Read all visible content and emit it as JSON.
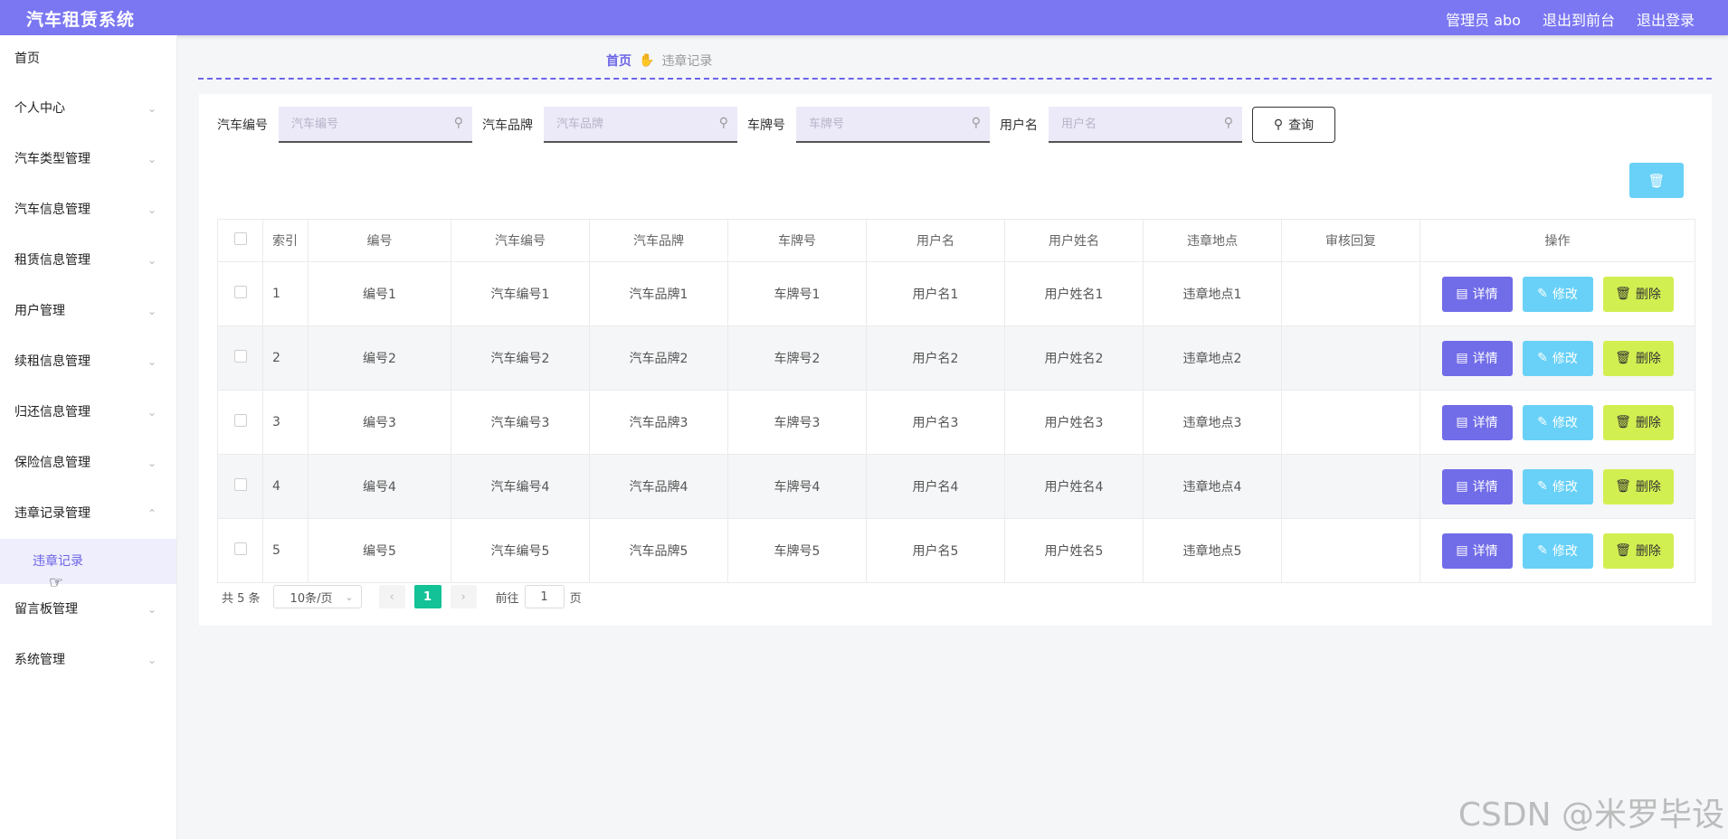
{
  "app": {
    "title": "汽车租赁系统"
  },
  "topnav": {
    "admin": "管理员 abo",
    "to_front": "退出到前台",
    "logout": "退出登录"
  },
  "sidebar": {
    "items": [
      {
        "label": "首页"
      },
      {
        "label": "个人中心"
      },
      {
        "label": "汽车类型管理"
      },
      {
        "label": "汽车信息管理"
      },
      {
        "label": "租赁信息管理"
      },
      {
        "label": "用户管理"
      },
      {
        "label": "续租信息管理"
      },
      {
        "label": "归还信息管理"
      },
      {
        "label": "保险信息管理"
      },
      {
        "label": "违章记录管理"
      },
      {
        "label": "留言板管理"
      },
      {
        "label": "系统管理"
      }
    ],
    "active_sub": "违章记录"
  },
  "breadcrumb": {
    "home": "首页",
    "current": "违章记录"
  },
  "search": {
    "f1": {
      "label": "汽车编号",
      "placeholder": "汽车编号"
    },
    "f2": {
      "label": "汽车品牌",
      "placeholder": "汽车品牌"
    },
    "f3": {
      "label": "车牌号",
      "placeholder": "车牌号"
    },
    "f4": {
      "label": "用户名",
      "placeholder": "用户名"
    },
    "button": "查询"
  },
  "table": {
    "columns": [
      "索引",
      "编号",
      "汽车编号",
      "汽车品牌",
      "车牌号",
      "用户名",
      "用户姓名",
      "违章地点",
      "审核回复",
      "操作"
    ],
    "rows": [
      {
        "idx": "1",
        "code": "编号1",
        "car_no": "汽车编号1",
        "brand": "汽车品牌1",
        "plate": "车牌号1",
        "user": "用户名1",
        "name": "用户姓名1",
        "place": "违章地点1",
        "reply": ""
      },
      {
        "idx": "2",
        "code": "编号2",
        "car_no": "汽车编号2",
        "brand": "汽车品牌2",
        "plate": "车牌号2",
        "user": "用户名2",
        "name": "用户姓名2",
        "place": "违章地点2",
        "reply": ""
      },
      {
        "idx": "3",
        "code": "编号3",
        "car_no": "汽车编号3",
        "brand": "汽车品牌3",
        "plate": "车牌号3",
        "user": "用户名3",
        "name": "用户姓名3",
        "place": "违章地点3",
        "reply": ""
      },
      {
        "idx": "4",
        "code": "编号4",
        "car_no": "汽车编号4",
        "brand": "汽车品牌4",
        "plate": "车牌号4",
        "user": "用户名4",
        "name": "用户姓名4",
        "place": "违章地点4",
        "reply": ""
      },
      {
        "idx": "5",
        "code": "编号5",
        "car_no": "汽车编号5",
        "brand": "汽车品牌5",
        "plate": "车牌号5",
        "user": "用户名5",
        "name": "用户姓名5",
        "place": "违章地点5",
        "reply": ""
      }
    ],
    "actions": {
      "detail": "详情",
      "edit": "修改",
      "delete": "删除"
    }
  },
  "pagination": {
    "total": "共 5 条",
    "page_size": "10条/页",
    "current_page": "1",
    "goto_label": "前往",
    "goto_value": "1",
    "page_suffix": "页"
  },
  "watermark": "CSDN @米罗毕设",
  "colors": {
    "topbar": "#7b77f2",
    "accent": "#6c65e6",
    "page_active": "#13c296",
    "detail_btn": "#716ce8",
    "edit_btn": "#69d1f7",
    "delete_btn": "#d2ef51"
  }
}
